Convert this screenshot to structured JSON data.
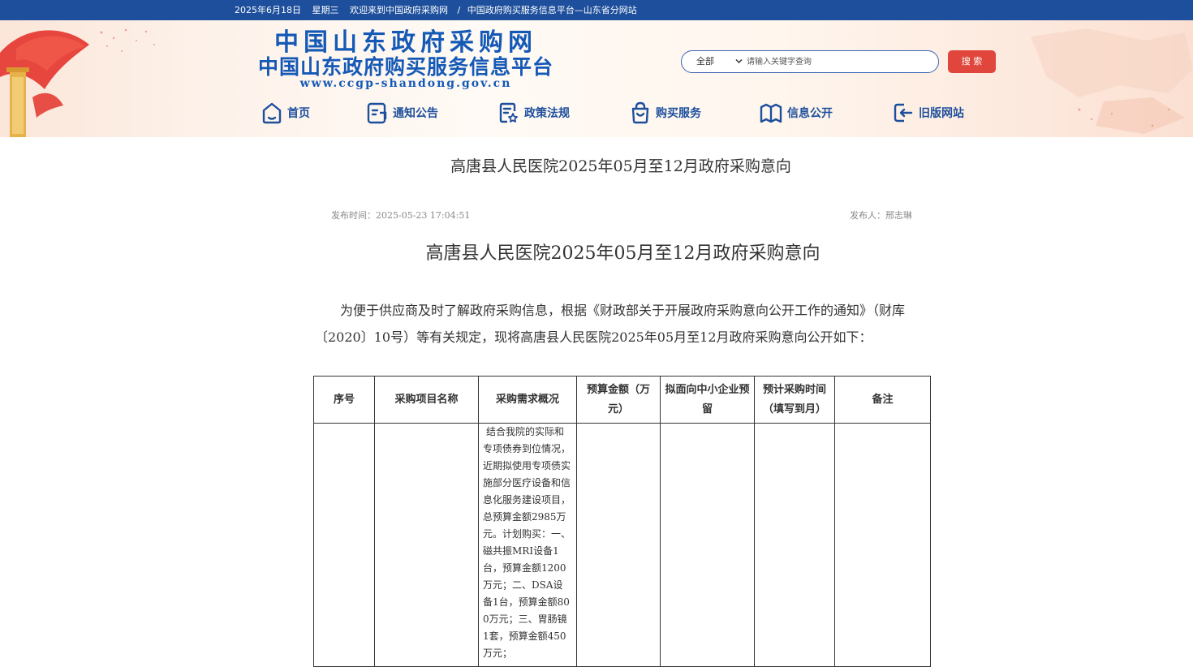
{
  "topbar": {
    "date": "2025年6月18日",
    "weekday": "星期三",
    "welcome": "欢迎来到中国政府采购网",
    "separator": "/",
    "platform": "中国政府购买服务信息平台—山东省分网站"
  },
  "header": {
    "logo_line1": "中国山东政府采购网",
    "logo_line2": "中国山东政府购买服务信息平台",
    "logo_url": "www.ccgp-shandong.gov.cn",
    "search": {
      "category": "全部",
      "placeholder": "请输入关键字查询",
      "button": "搜 索"
    },
    "nav": [
      {
        "label": "首页",
        "icon": "home-icon"
      },
      {
        "label": "通知公告",
        "icon": "notice-icon"
      },
      {
        "label": "政策法规",
        "icon": "policy-icon"
      },
      {
        "label": "购买服务",
        "icon": "shopping-bag-icon"
      },
      {
        "label": "信息公开",
        "icon": "book-open-icon"
      },
      {
        "label": "旧版网站",
        "icon": "back-arrow-icon"
      }
    ]
  },
  "article": {
    "page_title": "高唐县人民医院2025年05月至12月政府采购意向",
    "publish_time": "发布时间：2025-05-23 17:04:51",
    "publisher": "发布人：邢志琳",
    "doc_title": "高唐县人民医院2025年05月至12月政府采购意向",
    "intro": "为便于供应商及时了解政府采购信息，根据《财政部关于开展政府采购意向公开工作的通知》（财库〔2020〕10号）等有关规定，现将高唐县人民医院2025年05月至12月政府采购意向公开如下："
  },
  "table": {
    "headers": [
      "序号",
      "采购项目名称",
      "采购需求概况",
      "预算金额（万元）",
      "拟面向中小企业预留",
      "预计采购时间（填写到月）",
      "备注"
    ],
    "rows": [
      {
        "index": "",
        "name": "",
        "description": "结合我院的实际和专项债券到位情况，近期拟使用专项债实施部分医疗设备和信息化服务建设项目，总预算金额2985万元。计划购买：一、磁共振MRI设备1台，预算金额1200万元；二、DSA设备1台，预算金额800万元；三、胃肠镜1套，预算金额450万元；",
        "budget": "",
        "sme": "",
        "time": "",
        "remark": ""
      }
    ]
  }
}
